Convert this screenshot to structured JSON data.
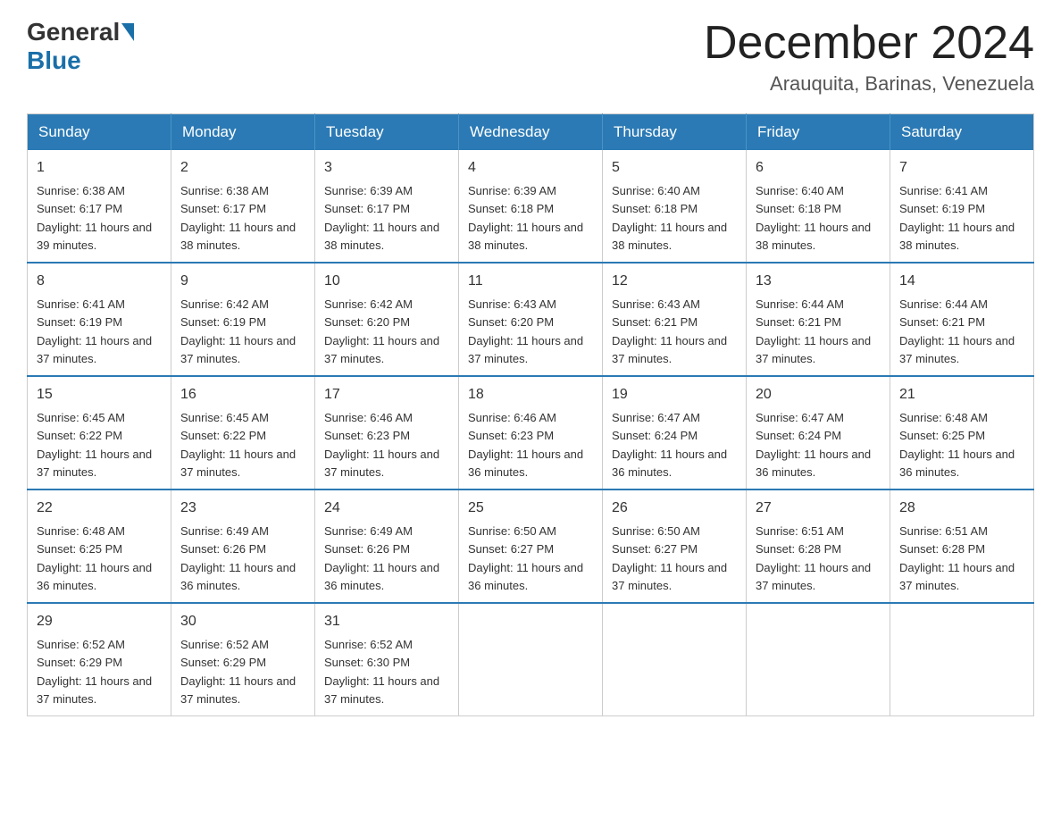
{
  "header": {
    "logo_general": "General",
    "logo_blue": "Blue",
    "month_title": "December 2024",
    "location": "Arauquita, Barinas, Venezuela"
  },
  "weekdays": [
    "Sunday",
    "Monday",
    "Tuesday",
    "Wednesday",
    "Thursday",
    "Friday",
    "Saturday"
  ],
  "weeks": [
    [
      {
        "day": "1",
        "sunrise": "6:38 AM",
        "sunset": "6:17 PM",
        "daylight": "11 hours and 39 minutes."
      },
      {
        "day": "2",
        "sunrise": "6:38 AM",
        "sunset": "6:17 PM",
        "daylight": "11 hours and 38 minutes."
      },
      {
        "day": "3",
        "sunrise": "6:39 AM",
        "sunset": "6:17 PM",
        "daylight": "11 hours and 38 minutes."
      },
      {
        "day": "4",
        "sunrise": "6:39 AM",
        "sunset": "6:18 PM",
        "daylight": "11 hours and 38 minutes."
      },
      {
        "day": "5",
        "sunrise": "6:40 AM",
        "sunset": "6:18 PM",
        "daylight": "11 hours and 38 minutes."
      },
      {
        "day": "6",
        "sunrise": "6:40 AM",
        "sunset": "6:18 PM",
        "daylight": "11 hours and 38 minutes."
      },
      {
        "day": "7",
        "sunrise": "6:41 AM",
        "sunset": "6:19 PM",
        "daylight": "11 hours and 38 minutes."
      }
    ],
    [
      {
        "day": "8",
        "sunrise": "6:41 AM",
        "sunset": "6:19 PM",
        "daylight": "11 hours and 37 minutes."
      },
      {
        "day": "9",
        "sunrise": "6:42 AM",
        "sunset": "6:19 PM",
        "daylight": "11 hours and 37 minutes."
      },
      {
        "day": "10",
        "sunrise": "6:42 AM",
        "sunset": "6:20 PM",
        "daylight": "11 hours and 37 minutes."
      },
      {
        "day": "11",
        "sunrise": "6:43 AM",
        "sunset": "6:20 PM",
        "daylight": "11 hours and 37 minutes."
      },
      {
        "day": "12",
        "sunrise": "6:43 AM",
        "sunset": "6:21 PM",
        "daylight": "11 hours and 37 minutes."
      },
      {
        "day": "13",
        "sunrise": "6:44 AM",
        "sunset": "6:21 PM",
        "daylight": "11 hours and 37 minutes."
      },
      {
        "day": "14",
        "sunrise": "6:44 AM",
        "sunset": "6:21 PM",
        "daylight": "11 hours and 37 minutes."
      }
    ],
    [
      {
        "day": "15",
        "sunrise": "6:45 AM",
        "sunset": "6:22 PM",
        "daylight": "11 hours and 37 minutes."
      },
      {
        "day": "16",
        "sunrise": "6:45 AM",
        "sunset": "6:22 PM",
        "daylight": "11 hours and 37 minutes."
      },
      {
        "day": "17",
        "sunrise": "6:46 AM",
        "sunset": "6:23 PM",
        "daylight": "11 hours and 37 minutes."
      },
      {
        "day": "18",
        "sunrise": "6:46 AM",
        "sunset": "6:23 PM",
        "daylight": "11 hours and 36 minutes."
      },
      {
        "day": "19",
        "sunrise": "6:47 AM",
        "sunset": "6:24 PM",
        "daylight": "11 hours and 36 minutes."
      },
      {
        "day": "20",
        "sunrise": "6:47 AM",
        "sunset": "6:24 PM",
        "daylight": "11 hours and 36 minutes."
      },
      {
        "day": "21",
        "sunrise": "6:48 AM",
        "sunset": "6:25 PM",
        "daylight": "11 hours and 36 minutes."
      }
    ],
    [
      {
        "day": "22",
        "sunrise": "6:48 AM",
        "sunset": "6:25 PM",
        "daylight": "11 hours and 36 minutes."
      },
      {
        "day": "23",
        "sunrise": "6:49 AM",
        "sunset": "6:26 PM",
        "daylight": "11 hours and 36 minutes."
      },
      {
        "day": "24",
        "sunrise": "6:49 AM",
        "sunset": "6:26 PM",
        "daylight": "11 hours and 36 minutes."
      },
      {
        "day": "25",
        "sunrise": "6:50 AM",
        "sunset": "6:27 PM",
        "daylight": "11 hours and 36 minutes."
      },
      {
        "day": "26",
        "sunrise": "6:50 AM",
        "sunset": "6:27 PM",
        "daylight": "11 hours and 37 minutes."
      },
      {
        "day": "27",
        "sunrise": "6:51 AM",
        "sunset": "6:28 PM",
        "daylight": "11 hours and 37 minutes."
      },
      {
        "day": "28",
        "sunrise": "6:51 AM",
        "sunset": "6:28 PM",
        "daylight": "11 hours and 37 minutes."
      }
    ],
    [
      {
        "day": "29",
        "sunrise": "6:52 AM",
        "sunset": "6:29 PM",
        "daylight": "11 hours and 37 minutes."
      },
      {
        "day": "30",
        "sunrise": "6:52 AM",
        "sunset": "6:29 PM",
        "daylight": "11 hours and 37 minutes."
      },
      {
        "day": "31",
        "sunrise": "6:52 AM",
        "sunset": "6:30 PM",
        "daylight": "11 hours and 37 minutes."
      },
      null,
      null,
      null,
      null
    ]
  ]
}
